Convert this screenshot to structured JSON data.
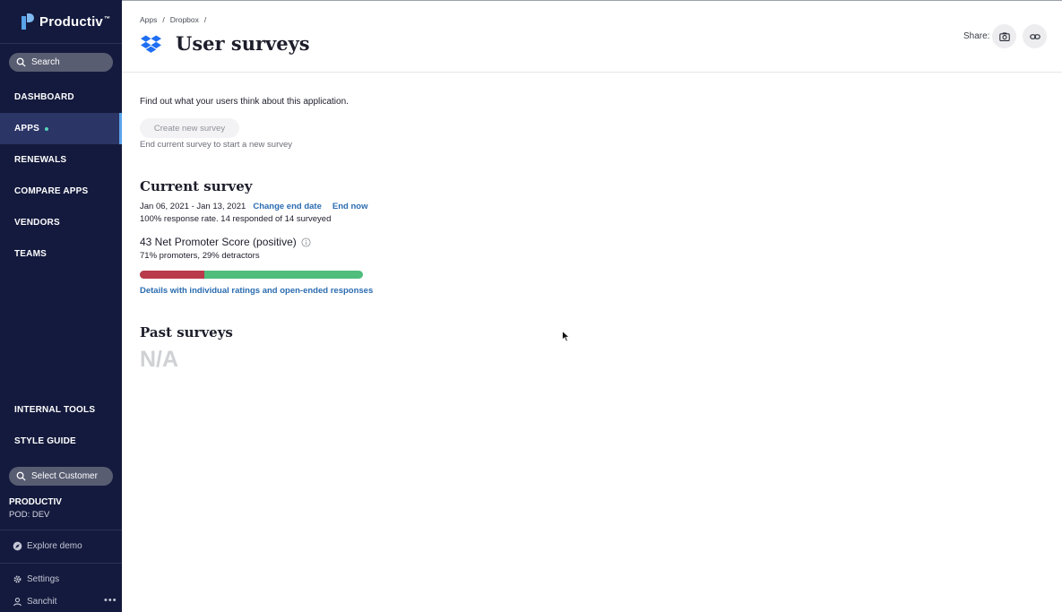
{
  "brand": {
    "name": "Productiv",
    "tm": "™",
    "accent": "#5aa3ea"
  },
  "sidebar": {
    "search_label": "Search",
    "nav": [
      {
        "label": "DASHBOARD",
        "active": false
      },
      {
        "label": "APPS",
        "active": true
      },
      {
        "label": "RENEWALS",
        "active": false
      },
      {
        "label": "COMPARE APPS",
        "active": false
      },
      {
        "label": "VENDORS",
        "active": false
      },
      {
        "label": "TEAMS",
        "active": false
      }
    ],
    "bottom_nav": [
      {
        "label": "INTERNAL TOOLS"
      },
      {
        "label": "STYLE GUIDE"
      }
    ],
    "select_customer_label": "Select Customer",
    "customer": {
      "name": "PRODUCTIV",
      "pod": "POD: DEV"
    },
    "explore_demo": "Explore demo",
    "settings": "Settings",
    "user": "Sanchit",
    "more": "•••"
  },
  "header": {
    "breadcrumb": [
      "Apps",
      "/",
      "Dropbox",
      "/"
    ],
    "title": "User surveys",
    "share_label": "Share:",
    "share_icons": [
      "camera-icon",
      "link-icon"
    ]
  },
  "main": {
    "intro": "Find out what your users think about this application.",
    "create_button": "Create new survey",
    "create_hint": "End current survey to start a new survey",
    "current": {
      "title": "Current survey",
      "dates": "Jan 06, 2021 - Jan 13, 2021",
      "change_end_date": "Change end date",
      "end_now": "End now",
      "response_rate": "100% response rate. 14 responded of 14 surveyed",
      "nps": "43 Net Promoter Score (positive)",
      "nps_breakdown": "71% promoters, 29% detractors",
      "detractor_fraction": 0.29,
      "promoter_color": "#4fbd7c",
      "detractor_color": "#b93a4a",
      "details_link": "Details with individual ratings and open-ended responses"
    },
    "past": {
      "title": "Past surveys",
      "empty": "N/A"
    }
  }
}
